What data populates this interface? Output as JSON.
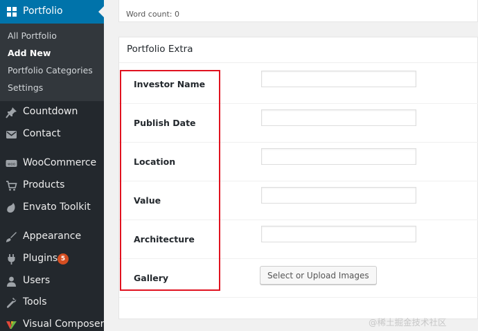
{
  "sidebar": {
    "active_menu": {
      "label": "Portfolio",
      "icon": "grid-icon"
    },
    "submenu": [
      {
        "label": "All Portfolio",
        "current": false
      },
      {
        "label": "Add New",
        "current": true
      },
      {
        "label": "Portfolio Categories",
        "current": false
      },
      {
        "label": "Settings",
        "current": false
      }
    ],
    "items": [
      {
        "label": "Countdown",
        "icon": "pin-icon"
      },
      {
        "label": "Contact",
        "icon": "mail-icon"
      },
      {
        "label": "WooCommerce",
        "icon": "woocommerce-icon"
      },
      {
        "label": "Products",
        "icon": "cart-icon"
      },
      {
        "label": "Envato Toolkit",
        "icon": "leaf-icon"
      },
      {
        "label": "Appearance",
        "icon": "paintbrush-icon"
      },
      {
        "label": "Plugins",
        "icon": "plug-icon",
        "badge": "5"
      },
      {
        "label": "Users",
        "icon": "users-icon"
      },
      {
        "label": "Tools",
        "icon": "wrench-icon"
      },
      {
        "label": "Visual Composer",
        "icon": "visual-composer-icon"
      }
    ]
  },
  "editor": {
    "word_count": "Word count: 0"
  },
  "metabox": {
    "title": "Portfolio Extra",
    "fields": [
      {
        "label": "Investor Name",
        "value": ""
      },
      {
        "label": "Publish Date",
        "value": ""
      },
      {
        "label": "Location",
        "value": ""
      },
      {
        "label": "Value",
        "value": ""
      },
      {
        "label": "Architecture",
        "value": ""
      }
    ],
    "gallery": {
      "label": "Gallery",
      "button_label": "Select or Upload Images"
    }
  },
  "watermark": "@稀土掘金技术社区",
  "colors": {
    "admin_bar": "#23282d",
    "active_menu": "#0073aa",
    "badge": "#d54e21",
    "highlight": "#e0121f"
  }
}
